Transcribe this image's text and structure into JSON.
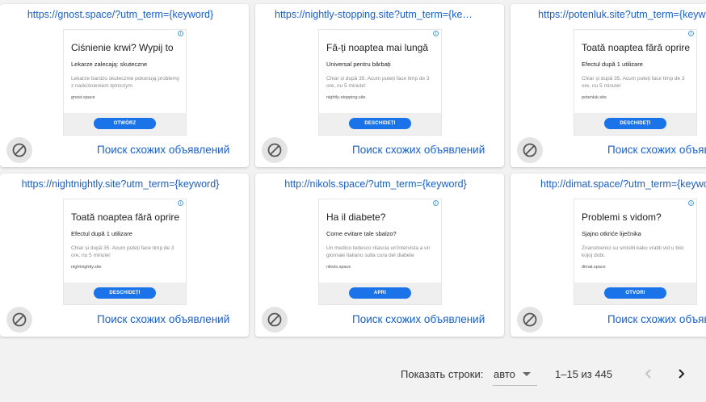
{
  "cards": [
    {
      "url": "https://gnost.space/?utm_term={keyword}",
      "ad": {
        "headline": "Ciśnienie krwi? Wypij to",
        "subline": "Lekarze zalecają: skuteczne",
        "description": "Lekarze bardzo skutecznie pokonują problemy z nadciśnieniem tętniczym",
        "domain": "gnost.space",
        "button": "OTWÓRZ"
      },
      "similar": "Поиск схожих объявлений"
    },
    {
      "url": "https://nightly-stopping.site?utm_term={keyword}",
      "ad": {
        "headline": "Fă-ți noaptea mai lungă",
        "subline": "Universal pentru bărbați",
        "description": "Chiar și după 35. Acum puteți face timp de 3 ore, nu 5 minute!",
        "domain": "nightly-stopping.site",
        "button": "DESCHIDEȚI"
      },
      "similar": "Поиск схожих объявлений"
    },
    {
      "url": "https://potenluk.site?utm_term={keyword}",
      "ad": {
        "headline": "Toată noaptea fără oprire",
        "subline": "Efectul după 1 utilizare",
        "description": "Chiar și după 35. Acum puteți face timp de 3 ore, nu 5 minute!",
        "domain": "potenluk.site",
        "button": "DESCHIDEȚI"
      },
      "similar": "Поиск схожих объявлений"
    },
    {
      "url": "https://nightnightly.site?utm_term={keyword}",
      "ad": {
        "headline": "Toată noaptea fără oprire",
        "subline": "Efectul după 1 utilizare",
        "description": "Chiar și după 35. Acum puteți face timp de 3 ore, nu 5 minute!",
        "domain": "nightnightly.site",
        "button": "DESCHIDEȚI"
      },
      "similar": "Поиск схожих объявлений"
    },
    {
      "url": "http://nikols.space/?utm_term={keyword}",
      "ad": {
        "headline": "Ha il diabete?",
        "subline": "Come evitare tale sbalzo?",
        "description": "Un medico tedesco rilascia un'intervista a un giornale italiano sulla cura del diabete",
        "domain": "nikols.space",
        "button": "APRI"
      },
      "similar": "Поиск схожих объявлений"
    },
    {
      "url": "http://dimat.space/?utm_term={keyword}",
      "ad": {
        "headline": "Problemi s vidom?",
        "subline": "Sjajno otkriće liječnika",
        "description": "Znanstvenici su smislili kako vratiti vid u bilo kojoj dobi.",
        "domain": "dimat.space",
        "button": "OTVORI"
      },
      "similar": "Поиск схожих объявлений"
    }
  ],
  "pagination": {
    "rows_label": "Показать строки:",
    "rows_value": "авто",
    "range": "1–15 из 445"
  },
  "icons": {
    "block": "block-icon",
    "prev": "chevron-left-icon",
    "next": "chevron-right-icon",
    "info": "ad-info-icon"
  },
  "colors": {
    "link": "#1a5fc7",
    "ad_button": "#1a73e8",
    "page_bg": "#f2f2f2"
  }
}
